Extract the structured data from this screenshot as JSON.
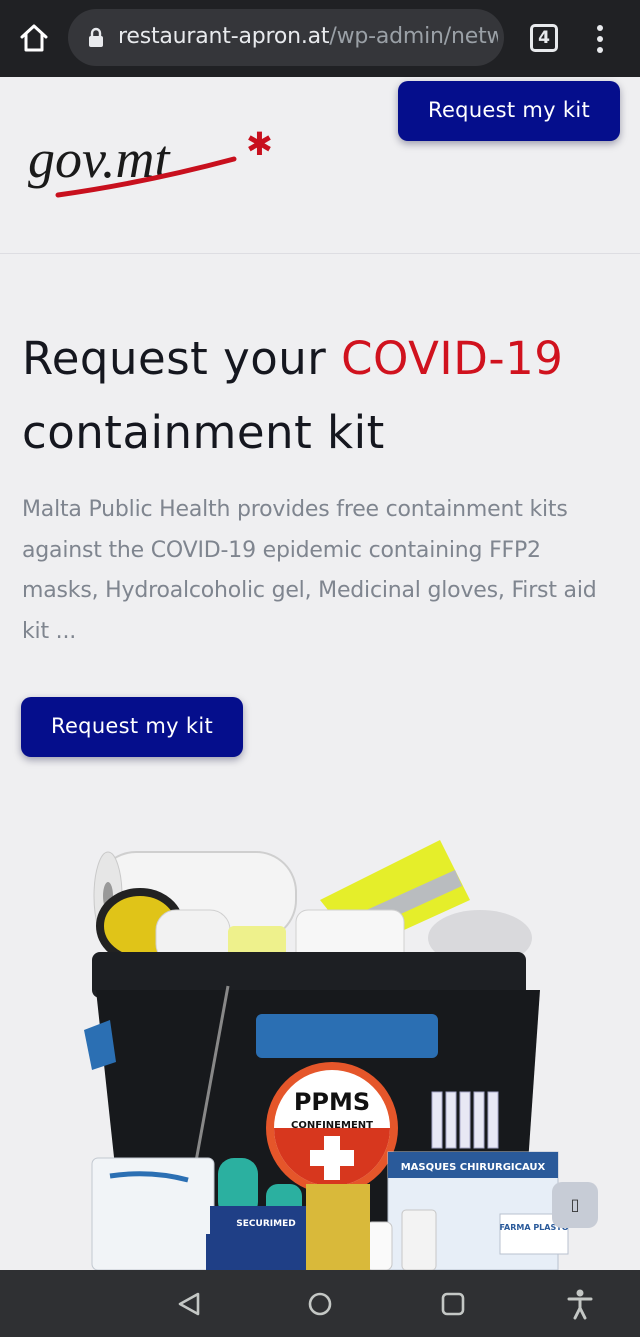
{
  "browser": {
    "url_host": "restaurant-apron.at",
    "url_path": "/wp-admin/netw",
    "tab_count": "4",
    "icons": [
      "home-icon",
      "lock-icon",
      "tabs-icon",
      "overflow-menu-icon"
    ]
  },
  "header": {
    "logo_text": "gov.mt",
    "cta_label": "Request my kit"
  },
  "main": {
    "title_part1": "Request your ",
    "title_accent": "COVID-19",
    "title_part2": " containment kit",
    "description": "Malta Public Health provides free containment kits against the COVID-19 epidemic containing FFP2 masks, Hydroalcoholic gel, Medicinal gloves, First aid kit ...",
    "cta_label": "Request my kit",
    "kit_labels": {
      "ppms": "PPMS",
      "confinement": "CONFINEMENT",
      "masques": "MASQUES CHIRURGICAUX",
      "securimed": "SECURIMED",
      "farma": "FARMA PLASTO"
    }
  },
  "chat_glyph": "▯",
  "android_nav": [
    "back-icon",
    "home-circle-icon",
    "recents-icon",
    "accessibility-icon"
  ],
  "colors": {
    "brand_blue": "#050e8c",
    "accent_red": "#d0121e",
    "page_bg": "#efeff1",
    "browser_bar": "#202124",
    "nav_bar": "#2f3033"
  }
}
